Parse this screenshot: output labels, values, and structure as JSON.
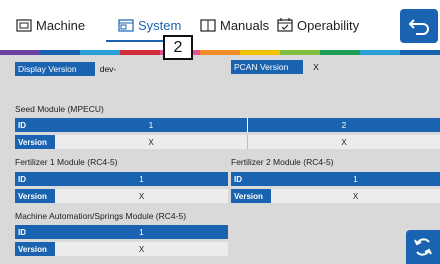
{
  "header": {
    "tabs": [
      {
        "label": "Machine",
        "icon": "machine-icon"
      },
      {
        "label": "System",
        "icon": "system-icon",
        "active": true
      },
      {
        "label": "Manuals",
        "icon": "book-icon"
      },
      {
        "label": "Operability",
        "icon": "calendar-check-icon"
      }
    ],
    "back_icon": "back-arrow-icon"
  },
  "callout": "2",
  "display_version": {
    "label": "Display Version",
    "value": "dev-"
  },
  "pcan_version": {
    "label": "PCAN Version",
    "value": "X"
  },
  "seed_module": {
    "title": "Seed Module (MPECU)",
    "id_label": "ID",
    "version_label": "Version",
    "ids": [
      "1",
      "2"
    ],
    "versions": [
      "X",
      "X"
    ]
  },
  "fertilizer1": {
    "title": "Fertilizer 1 Module (RC4-5)",
    "id_label": "ID",
    "version_label": "Version",
    "id": "1",
    "version": "X"
  },
  "fertilizer2": {
    "title": "Fertilizer 2 Module (RC4-5)",
    "id_label": "ID",
    "version_label": "Version",
    "id": "1",
    "version": "X"
  },
  "automation": {
    "title": "Machine Automation/Springs Module (RC4-5)",
    "id_label": "ID",
    "version_label": "Version",
    "id": "1",
    "version": "X"
  },
  "colors": {
    "accent": "#1a63b0",
    "background": "#d9d9d9"
  },
  "refresh_icon": "refresh-icon"
}
